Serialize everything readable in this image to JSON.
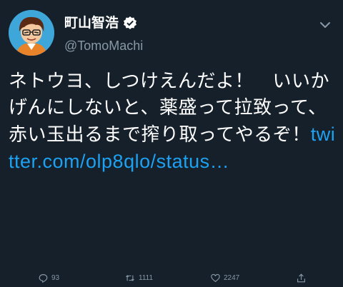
{
  "tweet": {
    "author": {
      "display_name": "町山智浩",
      "handle": "@TomoMachi",
      "verified": true,
      "avatar_icon": "cartoon-avatar"
    },
    "text": "ネトウヨ、しつけえんだよ！　いいかげんにしないと、薬盛って拉致って、赤い玉出るまで搾り取ってやるぞ！",
    "link_text": "twitter.com/olp8qlo/status…",
    "actions": {
      "reply_count": "93",
      "retweet_count": "1111",
      "like_count": "2247",
      "reply_icon": "reply-icon",
      "retweet_icon": "retweet-icon",
      "like_icon": "heart-icon",
      "share_icon": "share-icon"
    }
  },
  "colors": {
    "background": "#15202b",
    "text": "#ffffff",
    "secondary": "#8899a6",
    "link": "#1da1f2"
  }
}
